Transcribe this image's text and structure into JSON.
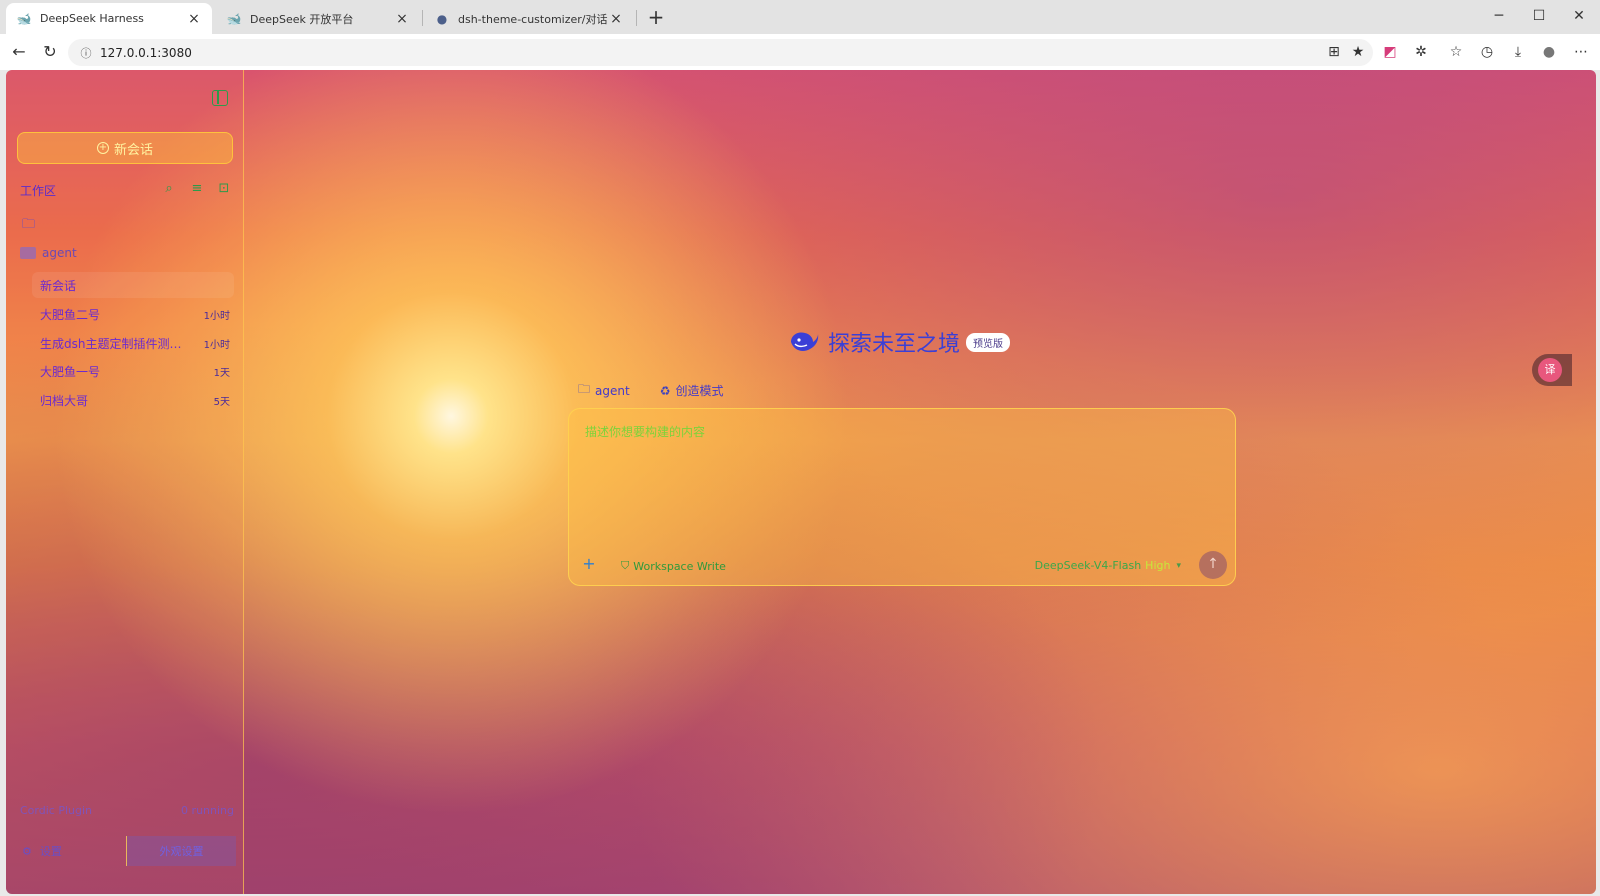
{
  "browser": {
    "tabs": [
      {
        "title": "DeepSeek Harness",
        "active": true,
        "favicon": "deepseek-whale-icon"
      },
      {
        "title": "DeepSeek 开放平台",
        "active": false,
        "favicon": "deepseek-whale-icon"
      },
      {
        "title": "dsh-theme-customizer/对话区测试",
        "active": false,
        "favicon": "github-icon"
      }
    ],
    "url": "127.0.0.1:3080"
  },
  "sidebar": {
    "new_chat_label": "新会话",
    "workspace_title": "工作区",
    "project_name": "agent",
    "chats": [
      {
        "name": "新会话",
        "time": "",
        "active": true
      },
      {
        "name": "大肥鱼二号",
        "time": "1小时"
      },
      {
        "name": "生成dsh主题定制插件测试...",
        "time": "1小时"
      },
      {
        "name": "大肥鱼一号",
        "time": "1天"
      },
      {
        "name": "归档大哥",
        "time": "5天"
      }
    ],
    "plugin_label": "Cordic Plugin",
    "plugin_status": "0 running",
    "settings_label": "设置",
    "bottom_right_label": "外观设置"
  },
  "main": {
    "hero_title": "探索未至之境",
    "hero_badge": "预览版",
    "context_folder": "agent",
    "context_mode": "创造模式",
    "composer_placeholder": "描述你想要构建的内容",
    "workspace_mode": "Workspace Write",
    "model_name": "DeepSeek-V4-Flash",
    "model_level": "High"
  }
}
